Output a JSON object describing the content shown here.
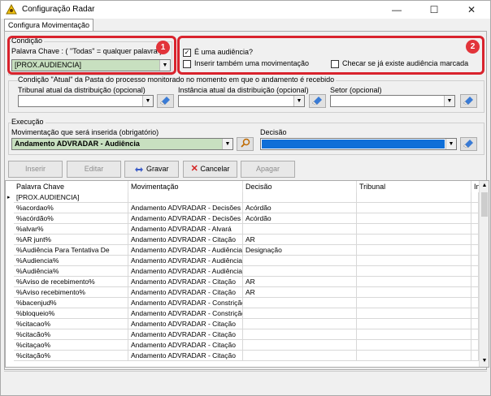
{
  "window": {
    "title": "Configuração Radar",
    "minimize": "—",
    "maximize": "☐",
    "close": "✕"
  },
  "tab": {
    "label": "Configura Movimentação"
  },
  "condicao": {
    "group": "Condição",
    "keyword_label": "Palavra Chave :  ( \"Todas\" = qualquer palavra )",
    "keyword_value": "[PROX.AUDIENCIA]",
    "badge": "1"
  },
  "audiencia": {
    "badge": "2",
    "is_audiencia": "É uma audiência?",
    "insert_also": "Inserir também uma movimentação",
    "check_exists": "Checar se já existe audiência marcada",
    "is_audiencia_checked": true
  },
  "condicao_atual": {
    "group": "Condição \"Atual\" da Pasta do processo monitorado no momento em que o andamento é recebido",
    "tribunal_label": "Tribunal atual da distribuição (opcional)",
    "instancia_label": "Instância atual da distribuição  (opcional)",
    "setor_label": "Setor  (opcional)"
  },
  "execucao": {
    "group": "Execução",
    "movimentacao_label": "Movimentação que será inserida (obrigatório)",
    "movimentacao_value": "Andamento ADVRADAR - Audiência",
    "decisao_label": "Decisão",
    "decisao_color": "#0f6fd8"
  },
  "toolbar": {
    "inserir": "Inserir",
    "editar": "Editar",
    "gravar": "Gravar",
    "cancelar": "Cancelar",
    "apagar": "Apagar"
  },
  "table": {
    "columns": [
      "Palavra Chave",
      "Movimentação",
      "Decisão",
      "Tribunal",
      "In"
    ],
    "rows": [
      [
        "[PROX.AUDIENCIA]",
        "",
        "",
        ""
      ],
      [
        "%acordao%",
        "Andamento ADVRADAR - Decisões",
        "Acórdão",
        ""
      ],
      [
        "%acórdão%",
        "Andamento ADVRADAR - Decisões",
        "Acórdão",
        ""
      ],
      [
        "%alvar%",
        "Andamento ADVRADAR - Alvará",
        "",
        ""
      ],
      [
        "%AR junt%",
        "Andamento ADVRADAR - Citação",
        "AR",
        ""
      ],
      [
        "%Audiência Para Tentativa De",
        "Andamento ADVRADAR - Audiência",
        "Designação",
        ""
      ],
      [
        "%Audiencia%",
        "Andamento ADVRADAR - Audiência",
        "",
        ""
      ],
      [
        "%Audiência%",
        "Andamento ADVRADAR - Audiência",
        "",
        ""
      ],
      [
        "%Aviso de recebimento%",
        "Andamento ADVRADAR - Citação",
        "AR",
        ""
      ],
      [
        "%Aviso recebimento%",
        "Andamento ADVRADAR - Citação",
        "AR",
        ""
      ],
      [
        "%bacenjud%",
        "Andamento ADVRADAR - Constrição",
        "",
        ""
      ],
      [
        "%bloqueio%",
        "Andamento ADVRADAR - Constrição",
        "",
        ""
      ],
      [
        "%citacao%",
        "Andamento ADVRADAR - Citação",
        "",
        ""
      ],
      [
        "%citacão%",
        "Andamento ADVRADAR - Citação",
        "",
        ""
      ],
      [
        "%citaçao%",
        "Andamento ADVRADAR - Citação",
        "",
        ""
      ],
      [
        "%citação%",
        "Andamento ADVRADAR - Citação",
        "",
        ""
      ]
    ]
  },
  "colors": {
    "highlight": "#d9232d",
    "field_green": "#c8e0c0",
    "accent_blue": "#0f6fd8"
  }
}
